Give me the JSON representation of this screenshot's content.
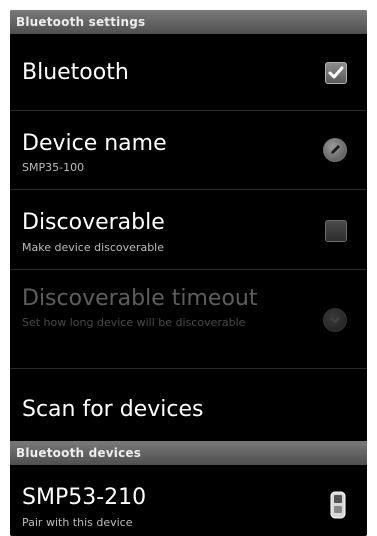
{
  "header_settings": "Bluetooth settings",
  "items": [
    {
      "title": "Bluetooth",
      "checked": true
    },
    {
      "title": "Device name",
      "subtitle": "SMP35-100"
    },
    {
      "title": "Discoverable",
      "subtitle": "Make device discoverable",
      "checked": false
    },
    {
      "title": "Discoverable timeout",
      "subtitle": "Set how long device will be discoverable",
      "enabled": false
    },
    {
      "title": "Scan for devices"
    }
  ],
  "header_devices": "Bluetooth devices",
  "devices": [
    {
      "name": "SMP53-210",
      "subtitle": "Pair with this device",
      "icon": "phone-icon"
    }
  ],
  "colors": {
    "background": "#000000",
    "header": "#5f5f5f",
    "text": "#ffffff",
    "subtext": "#bdbdbd"
  }
}
